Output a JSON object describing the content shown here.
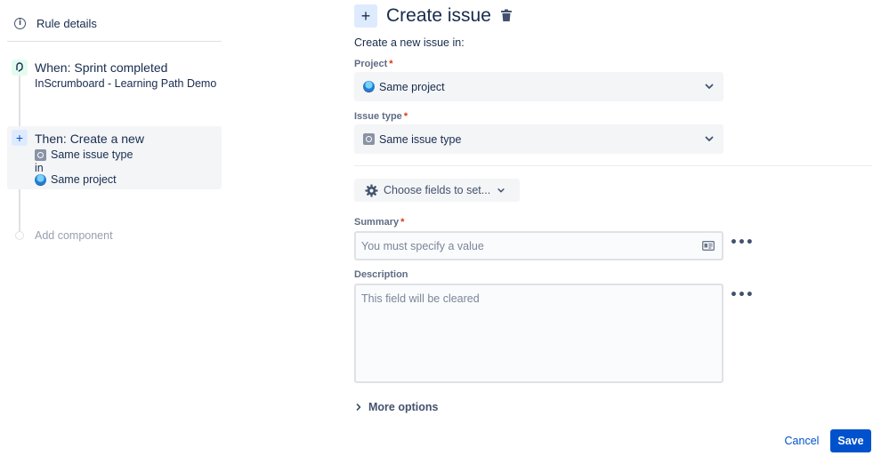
{
  "sidebar": {
    "rule_details": "Rule details",
    "trigger": {
      "title": "When: Sprint completed",
      "prefix": "In",
      "board": "Scrumboard - Learning Path Demo"
    },
    "action": {
      "title": "Then: Create a new",
      "issue_type": "Same issue type",
      "in": "in",
      "project": "Same project"
    },
    "add_component": "Add component"
  },
  "form": {
    "title": "Create issue",
    "subtitle": "Create a new issue in:",
    "project": {
      "label": "Project",
      "required_mark": "*",
      "value": "Same project"
    },
    "issue_type": {
      "label": "Issue type",
      "required_mark": "*",
      "value": "Same issue type"
    },
    "choose_fields": "Choose fields to set...",
    "summary": {
      "label": "Summary",
      "required_mark": "*",
      "placeholder": "You must specify a value"
    },
    "description": {
      "label": "Description",
      "placeholder": "This field will be cleared"
    },
    "more_options": "More options",
    "cancel": "Cancel",
    "save": "Save"
  },
  "colors": {
    "primary": "#0052CC",
    "required": "#DE350B",
    "text": "#172B4D",
    "muted": "#97A0AF"
  },
  "icons": [
    "info-icon",
    "trigger-icon",
    "plus-icon",
    "issue-type-icon",
    "project-icon",
    "trash-icon",
    "chevron-down-icon",
    "gear-icon",
    "field-card-icon",
    "more-icon",
    "chevron-right-icon"
  ]
}
